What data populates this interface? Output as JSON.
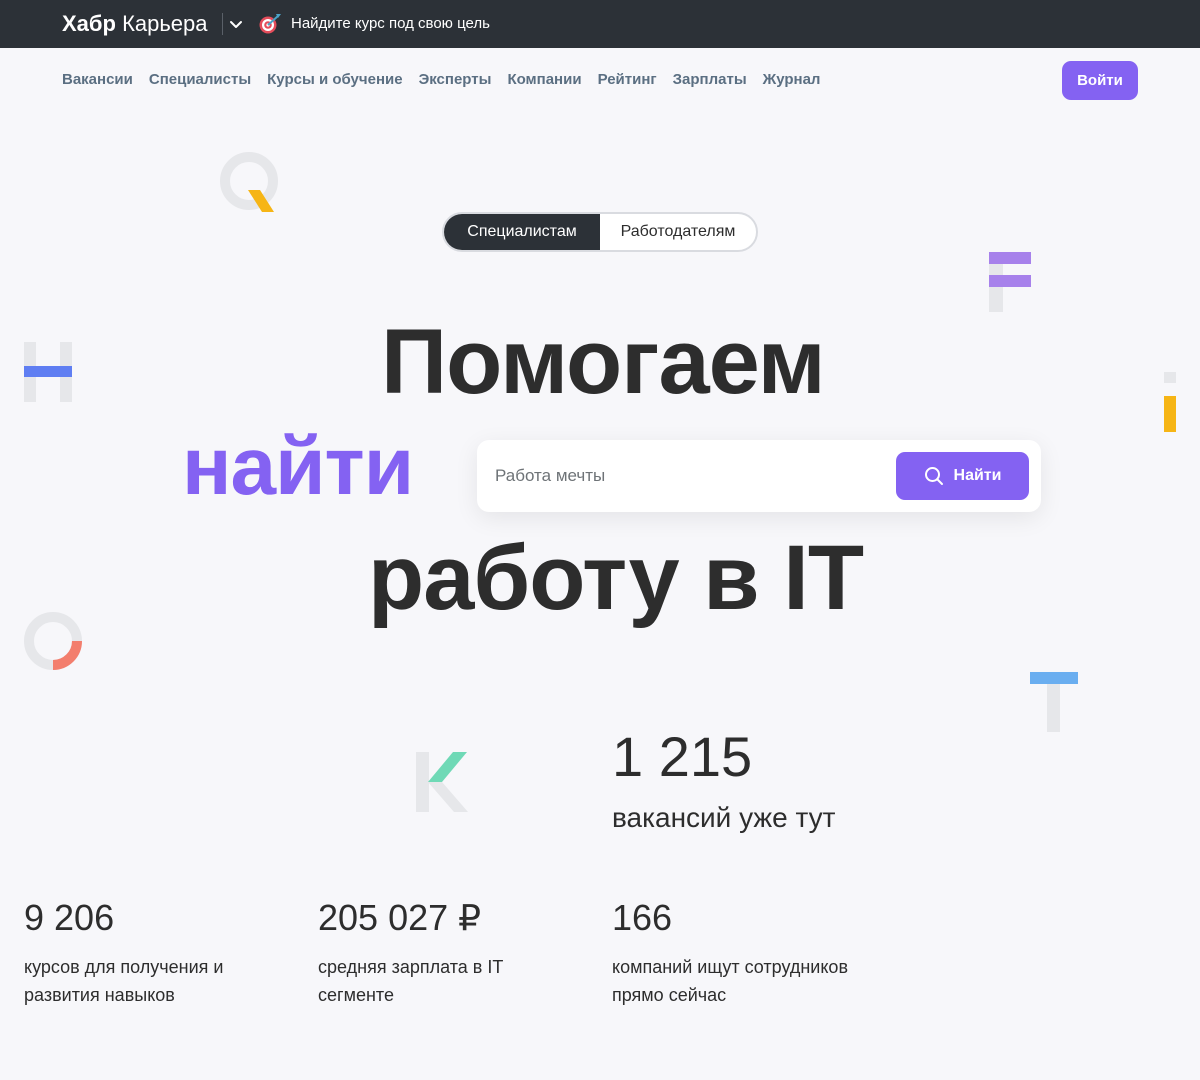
{
  "topbar": {
    "brand_bold": "Хабр",
    "brand_regular": "Карьера",
    "promo_text": "Найдите курс под свою цель"
  },
  "nav": {
    "items": [
      "Вакансии",
      "Специалисты",
      "Курсы и обучение",
      "Эксперты",
      "Компании",
      "Рейтинг",
      "Зарплаты",
      "Журнал"
    ],
    "login_label": "Войти"
  },
  "audience_toggle": {
    "options": [
      "Специалистам",
      "Работодателям"
    ],
    "selected": "Специалистам"
  },
  "hero": {
    "line1": "Помогаем",
    "line2": "найти",
    "line3": "работу в IT"
  },
  "search": {
    "placeholder": "Работа мечты",
    "value": "",
    "button_label": "Найти"
  },
  "stats": {
    "vacancies": {
      "value": "1 215",
      "label": "вакансий уже тут"
    },
    "courses": {
      "value": "9 206",
      "label": "курсов для получения и развития навыков"
    },
    "salary": {
      "value": "205 027 ₽",
      "label": "средняя зарплата в IT сегменте"
    },
    "companies": {
      "value": "166",
      "label": "компаний ищут сотрудников прямо сейчас"
    }
  },
  "colors": {
    "accent": "#8462f2",
    "topbar_bg": "#2c3137",
    "nav_text": "#5b6f82",
    "page_bg": "#f7f7fa"
  }
}
